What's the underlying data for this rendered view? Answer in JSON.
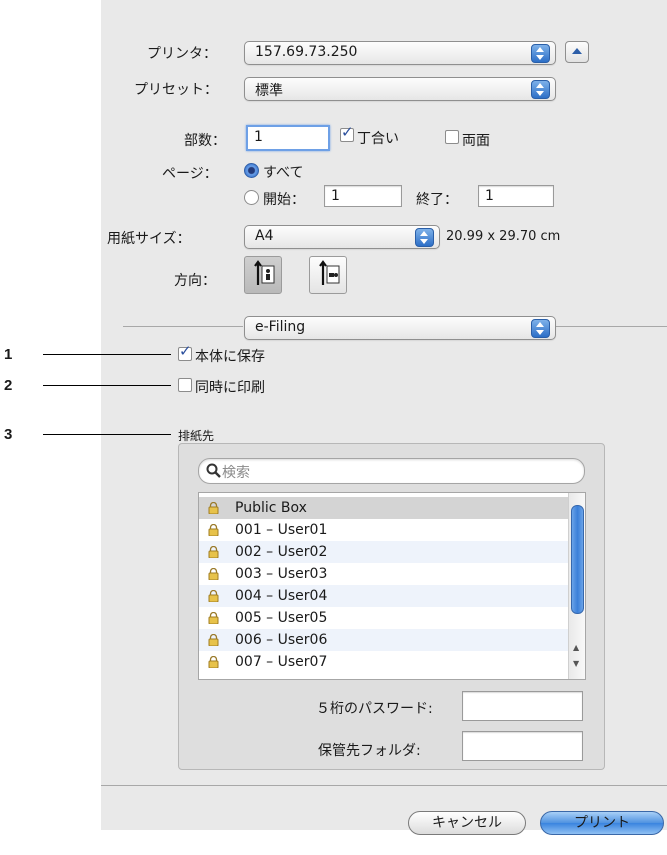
{
  "printer": {
    "label": "プリンタ：",
    "value": "157.69.73.250"
  },
  "preset": {
    "label": "プリセット：",
    "value": "標準"
  },
  "copies": {
    "label": "部数：",
    "value": "1",
    "collate_label": "丁合い",
    "collate_checked": true,
    "duplex_label": "両面",
    "duplex_checked": false
  },
  "pages": {
    "label": "ページ：",
    "all_label": "すべて",
    "from_label": "開始：",
    "from_value": "1",
    "to_label": "終了：",
    "to_value": "1",
    "selected": "all"
  },
  "paper": {
    "label": "用紙サイズ：",
    "value": "A4",
    "dimensions": "20.99 x 29.70 cm"
  },
  "orientation": {
    "label": "方向：",
    "selected": "portrait"
  },
  "section_popup": {
    "value": "e-Filing"
  },
  "options": {
    "save_label": "本体に保存",
    "save_checked": true,
    "print_label": "同時に印刷",
    "print_checked": false
  },
  "destination": {
    "label": "排紙先",
    "search_placeholder": "検索",
    "boxes": [
      {
        "name": "Public Box",
        "selected": true
      },
      {
        "name": "001 – User01"
      },
      {
        "name": "002 – User02"
      },
      {
        "name": "003 – User03"
      },
      {
        "name": "004 – User04"
      },
      {
        "name": "005 – User05"
      },
      {
        "name": "006 – User06"
      },
      {
        "name": "007 – User07"
      }
    ],
    "password_label": "５桁のパスワード:",
    "folder_label": "保管先フォルダ:"
  },
  "buttons": {
    "cancel": "キャンセル",
    "print": "プリント"
  },
  "callouts": [
    "1",
    "2",
    "3"
  ]
}
